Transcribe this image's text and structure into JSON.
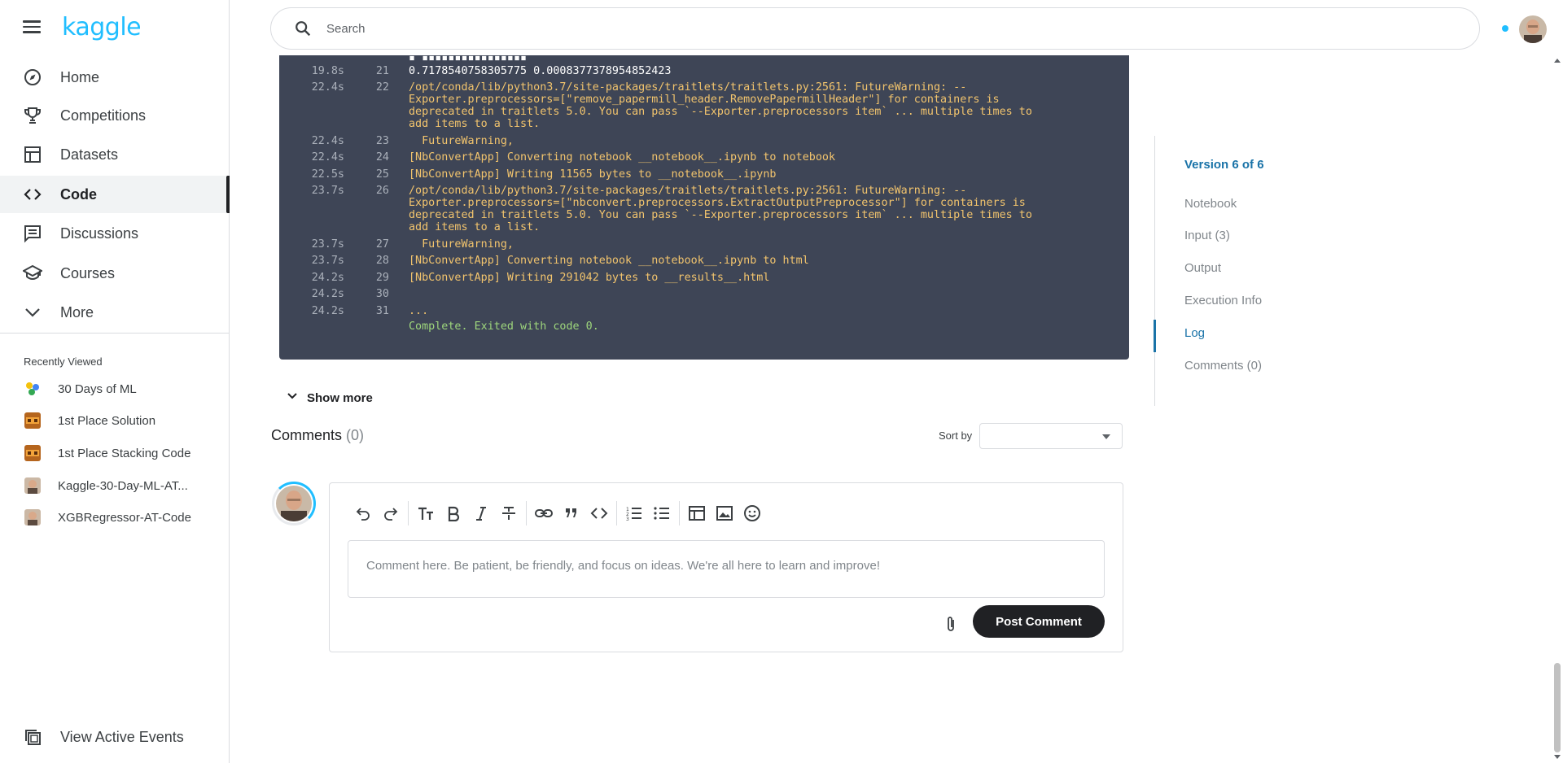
{
  "brand": {
    "logo_text": "kaggle",
    "accent": "#20beff",
    "link_blue": "#1a73a8"
  },
  "sidebar": {
    "nav_items": [
      {
        "label": "Home",
        "icon": "compass-icon"
      },
      {
        "label": "Competitions",
        "icon": "trophy-icon"
      },
      {
        "label": "Datasets",
        "icon": "table-icon"
      },
      {
        "label": "Code",
        "icon": "code-icon",
        "active": true
      },
      {
        "label": "Discussions",
        "icon": "comments-icon"
      },
      {
        "label": "Courses",
        "icon": "school-icon"
      },
      {
        "label": "More",
        "icon": "chevron-down-icon"
      }
    ],
    "recently_viewed_title": "Recently Viewed",
    "recent_items": [
      {
        "label": "30 Days of ML"
      },
      {
        "label": "1st Place Solution"
      },
      {
        "label": "1st Place Stacking Code"
      },
      {
        "label": "Kaggle-30-Day-ML-AT..."
      },
      {
        "label": "XGBRegressor-AT-Code"
      }
    ],
    "view_events_label": "View Active Events"
  },
  "search": {
    "placeholder": "Search"
  },
  "log": {
    "lines": [
      {
        "time": "19.8s",
        "num": "21",
        "text": "0.7178540758305775 0.0008377378954852423",
        "style": "white"
      },
      {
        "time": "22.4s",
        "num": "22",
        "text": "/opt/conda/lib/python3.7/site-packages/traitlets/traitlets.py:2561: FutureWarning: --\nExporter.preprocessors=[\"remove_papermill_header.RemovePapermillHeader\"] for containers is\ndeprecated in traitlets 5.0. You can pass `--Exporter.preprocessors item` ... multiple times to\nadd items to a list.",
        "style": "yellow"
      },
      {
        "time": "22.4s",
        "num": "23",
        "text": "  FutureWarning,",
        "style": "yellow"
      },
      {
        "time": "22.4s",
        "num": "24",
        "text": "[NbConvertApp] Converting notebook __notebook__.ipynb to notebook",
        "style": "yellow"
      },
      {
        "time": "22.5s",
        "num": "25",
        "text": "[NbConvertApp] Writing 11565 bytes to __notebook__.ipynb",
        "style": "yellow"
      },
      {
        "time": "23.7s",
        "num": "26",
        "text": "/opt/conda/lib/python3.7/site-packages/traitlets/traitlets.py:2561: FutureWarning: --\nExporter.preprocessors=[\"nbconvert.preprocessors.ExtractOutputPreprocessor\"] for containers is\ndeprecated in traitlets 5.0. You can pass `--Exporter.preprocessors item` ... multiple times to\nadd items to a list.",
        "style": "yellow"
      },
      {
        "time": "23.7s",
        "num": "27",
        "text": "  FutureWarning,",
        "style": "yellow"
      },
      {
        "time": "23.7s",
        "num": "28",
        "text": "[NbConvertApp] Converting notebook __notebook__.ipynb to html",
        "style": "yellow"
      },
      {
        "time": "24.2s",
        "num": "29",
        "text": "[NbConvertApp] Writing 291042 bytes to __results__.html",
        "style": "yellow"
      },
      {
        "time": "24.2s",
        "num": "30",
        "text": "",
        "style": "yellow"
      },
      {
        "time": "24.2s",
        "num": "31",
        "text": "...",
        "style": "yellow"
      }
    ],
    "exit_message": "Complete. Exited with code 0."
  },
  "show_more_label": "Show more",
  "comments": {
    "title": "Comments",
    "count": "(0)",
    "sort_label": "Sort by",
    "sort_value": "",
    "input_placeholder": "Comment here. Be patient, be friendly, and focus on ideas. We're all here to learn and improve!",
    "post_label": "Post Comment"
  },
  "toc": {
    "version_label": "Version 6 of 6",
    "items": [
      "Notebook",
      "Input (3)",
      "Output",
      "Execution Info",
      "Log",
      "Comments (0)"
    ],
    "active": "Log"
  }
}
